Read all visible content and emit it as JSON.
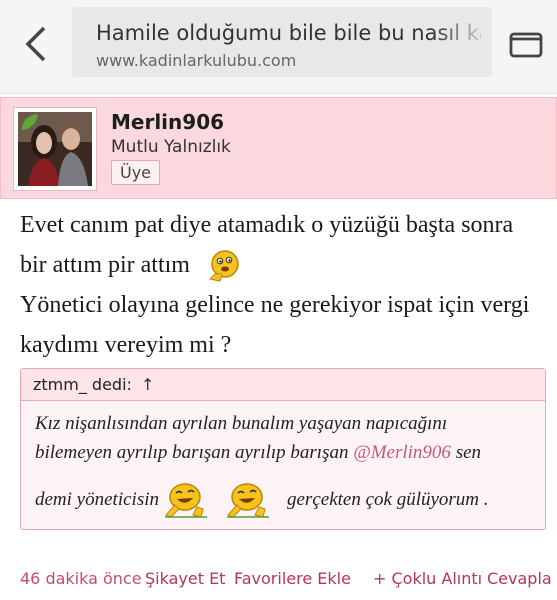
{
  "browser": {
    "page_title": "Hamile olduğumu bile bile bu nasıl kadın b",
    "domain": "www.kadinlarkulubu.com"
  },
  "user": {
    "name": "Merlin906",
    "title": "Mutlu Yalnızlık",
    "role": "Üye"
  },
  "post": {
    "line1": "Evet canım pat diye atamadık o yüzüğü başta sonra",
    "line2": "bir attım pir attım",
    "line3": "Yönetici olayına gelince ne gerekiyor ispat için vergi",
    "line4": "kaydımı vereyim mi ?"
  },
  "quote": {
    "author": "ztmm_ dedi:",
    "arrow": "↑",
    "line1": "Kız nişanlısından ayrılan bunalım yaşayan napıcağını",
    "line2_start": "bilemeyen ayrılıp barışan ayrılıp barışan ",
    "mention": "@Merlin906",
    "line2_end": " sen",
    "line3_start": "demi yöneticisin",
    "line3_end": "gerçekten çok gülüyorum ."
  },
  "footer": {
    "time": "46 dakika önce",
    "report": "Şikayet Et",
    "favorite": "Favorilere Ekle",
    "multi_quote": "+ Çoklu Alıntı",
    "reply": "Cevapla"
  }
}
